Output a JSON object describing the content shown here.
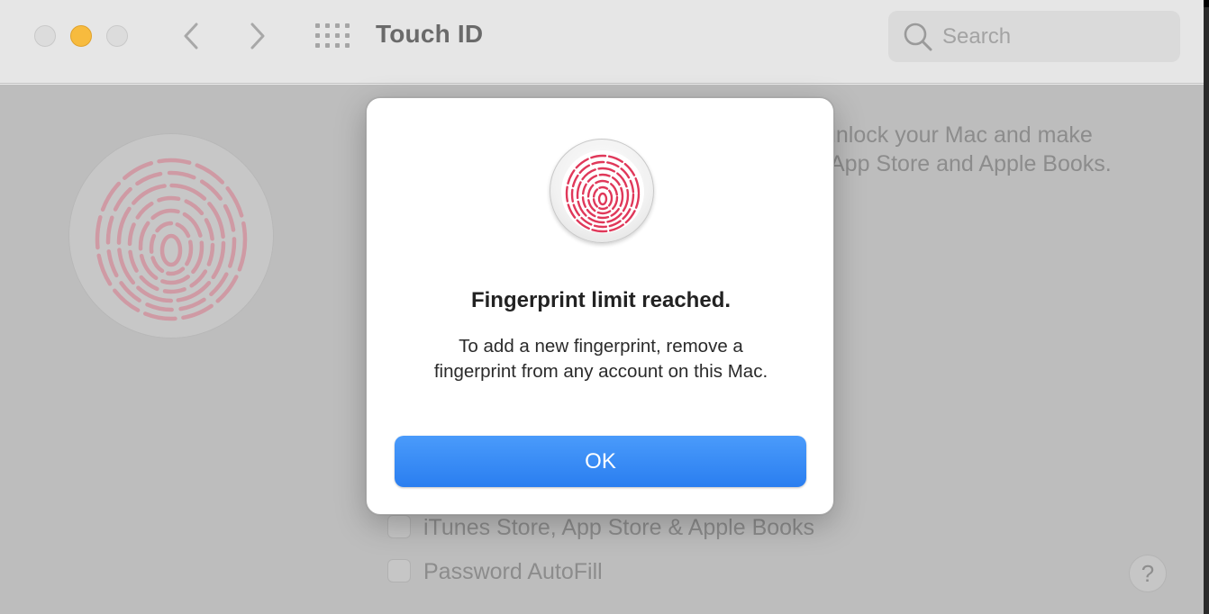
{
  "window": {
    "title": "Touch ID",
    "search": {
      "placeholder": "Search",
      "value": ""
    }
  },
  "background": {
    "description_line1": "unlock your Mac and make",
    "description_line2": "App Store and Apple Books.",
    "options": [
      {
        "label": "iTunes Store, App Store & Apple Books",
        "checked": false
      },
      {
        "label": "Password AutoFill",
        "checked": false
      }
    ],
    "help_label": "?"
  },
  "dialog": {
    "title": "Fingerprint limit reached.",
    "message": "To add a new fingerprint, remove a fingerprint from any account on this Mac.",
    "ok_label": "OK"
  },
  "icons": {
    "fingerprint": "fingerprint-icon",
    "search": "search-icon",
    "back": "chevron-left-icon",
    "forward": "chevron-right-icon",
    "grid": "grid-icon"
  },
  "colors": {
    "accent": "#2f83f3",
    "fingerprint_red": "#e0385a",
    "minimize_yellow": "#f7bb3e"
  }
}
